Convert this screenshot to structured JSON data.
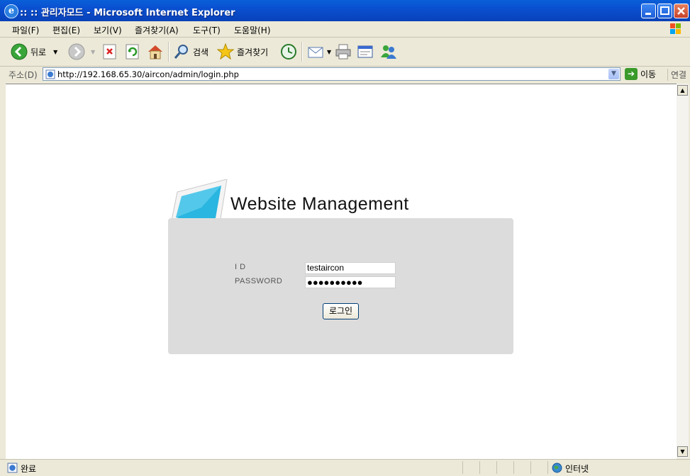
{
  "window": {
    "title": ":: :: 관리자모드 - Microsoft Internet Explorer"
  },
  "menu": [
    "파일(F)",
    "편집(E)",
    "보기(V)",
    "즐겨찾기(A)",
    "도구(T)",
    "도움말(H)"
  ],
  "toolbar": {
    "back_label": "뒤로",
    "search_label": "검색",
    "favorites_label": "즐겨찾기"
  },
  "address": {
    "label": "주소(D)",
    "url": "http://192.168.65.30/aircon/admin/login.php",
    "go_label": "이동",
    "links_label": "연결"
  },
  "page": {
    "brand": "Website Management",
    "id_label": "I D",
    "password_label": "PASSWORD",
    "id_value": "testaircon",
    "password_value": "●●●●●●●●●●",
    "login_button": "로그인"
  },
  "status": {
    "text": "완료",
    "zone": "인터넷"
  },
  "colors": {
    "title_bar": "#0a4fd0",
    "panel_bg": "#dcdcdc",
    "monitor_screen": "#29b6e0"
  }
}
